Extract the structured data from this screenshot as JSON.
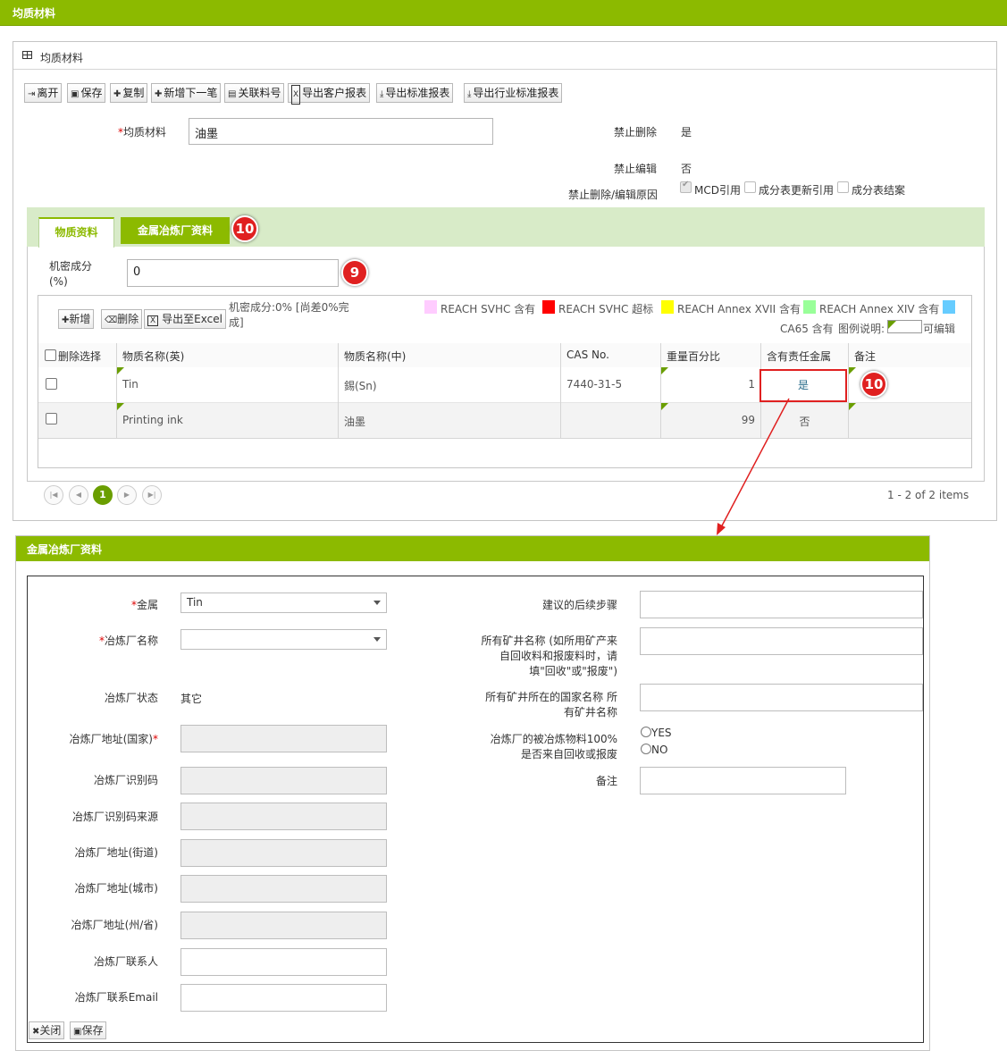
{
  "page_title": "均质材料",
  "panel": {
    "title": "均质材料",
    "toolbar": [
      {
        "label": "离开",
        "icon": "exit-icon",
        "glyph": "⇥"
      },
      {
        "label": "保存",
        "icon": "save-icon",
        "glyph": "🖫"
      },
      {
        "label": "复制",
        "icon": "plus-icon",
        "glyph": "✚"
      },
      {
        "label": "新增下一笔",
        "icon": "plus-icon",
        "glyph": "✚"
      },
      {
        "label": "关联料号",
        "icon": "document-icon",
        "glyph": "▤"
      },
      {
        "label": "导出客户报表",
        "icon": "excel-icon",
        "glyph": "X"
      },
      {
        "label": "导出标准报表",
        "icon": "download-icon",
        "glyph": "⤓"
      },
      {
        "label": "导出行业标准报表",
        "icon": "download-icon",
        "glyph": "⤓"
      }
    ]
  },
  "form": {
    "material_label": "均质材料",
    "material_value": "油墨",
    "no_delete_label": "禁止删除",
    "no_delete_value": "是",
    "no_edit_label": "禁止编辑",
    "no_edit_value": "否",
    "reason_label": "禁止删除/编辑原因",
    "reason_options": [
      "MCD引用",
      "成分表更新引用",
      "成分表结案"
    ]
  },
  "tabs": [
    "物质资料",
    "金属冶炼厂资料"
  ],
  "badges": {
    "tab": "10",
    "confidential": "9",
    "cell": "10"
  },
  "confidential": {
    "label": "机密成分 (%)",
    "value": "0"
  },
  "grid": {
    "buttons": [
      {
        "label": "新增",
        "glyph": "✚",
        "icon": "plus-icon"
      },
      {
        "label": "删除",
        "glyph": "🗑",
        "icon": "trash-icon"
      },
      {
        "label": "导出至Excel",
        "glyph": "X",
        "icon": "excel-icon"
      }
    ],
    "status_text": "机密成分:0% [尚差0%完成]",
    "legend": [
      {
        "label": "REACH SVHC 含有",
        "color": "#ffccff"
      },
      {
        "label": "REACH SVHC 超标",
        "color": "#ff0000"
      },
      {
        "label": "REACH Annex XVII 含有",
        "color": "#ffff00"
      },
      {
        "label": "REACH Annex XIV 含有",
        "color": "#99ff99"
      },
      {
        "label": "CA65 含有",
        "color": "#66ccff"
      }
    ],
    "legend_title": "图例说明:",
    "editable_label": "可编辑",
    "columns": [
      "删除选择",
      "物质名称(英)",
      "物质名称(中)",
      "CAS No.",
      "重量百分比",
      "含有责任金属",
      "备注"
    ],
    "rows": [
      {
        "en": "Tin",
        "cn": "錫(Sn)",
        "cas": "7440-31-5",
        "pct": "1",
        "metal": "是",
        "note": ""
      },
      {
        "en": "Printing ink",
        "cn": "油墨",
        "cas": "",
        "pct": "99",
        "metal": "否",
        "note": ""
      }
    ],
    "pager": {
      "current": "1",
      "summary": "1 - 2 of 2 items"
    }
  },
  "popup": {
    "title": "金属冶炼厂资料",
    "left_fields": [
      {
        "label": "金属",
        "required": "pre",
        "type": "select",
        "value": "Tin"
      },
      {
        "label": "冶炼厂名称",
        "required": "pre",
        "type": "select",
        "value": ""
      },
      {
        "label": "冶炼厂状态",
        "required": "",
        "type": "text",
        "value": "其它"
      },
      {
        "label": "冶炼厂地址(国家)",
        "required": "post",
        "type": "readonly",
        "value": ""
      },
      {
        "label": "冶炼厂识别码",
        "required": "",
        "type": "readonly",
        "value": ""
      },
      {
        "label": "冶炼厂识别码来源",
        "required": "",
        "type": "readonly",
        "value": ""
      },
      {
        "label": "冶炼厂地址(街道)",
        "required": "",
        "type": "readonly",
        "value": ""
      },
      {
        "label": "冶炼厂地址(城市)",
        "required": "",
        "type": "readonly",
        "value": ""
      },
      {
        "label": "冶炼厂地址(州/省)",
        "required": "",
        "type": "readonly",
        "value": ""
      },
      {
        "label": "冶炼厂联系人",
        "required": "",
        "type": "input",
        "value": ""
      },
      {
        "label": "冶炼厂联系Email",
        "required": "",
        "type": "input",
        "value": ""
      }
    ],
    "right_fields": {
      "next_steps": "建议的后续步骤",
      "mine_names": "所有矿井名称 (如所用矿产来自回收料和报废料时，请填\"回收\"或\"报废\")",
      "mine_country": "所有矿井所在的国家名称 所有矿井名称",
      "recycled_label": "冶炼厂的被冶炼物料100% 是否来自回收或报废",
      "yes": "YES",
      "no": "NO",
      "remark": "备注"
    },
    "buttons": [
      {
        "label": "关闭",
        "glyph": "✖",
        "icon": "close-icon"
      },
      {
        "label": "保存",
        "glyph": "🖫",
        "icon": "save-icon"
      }
    ]
  },
  "colors": {
    "brand": "#8cba00",
    "highlight": "#e02020"
  }
}
